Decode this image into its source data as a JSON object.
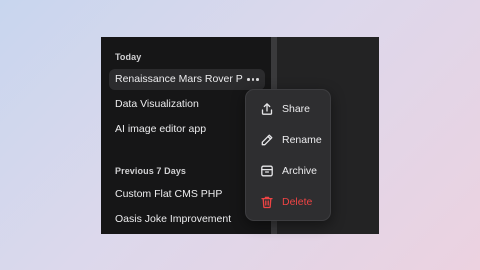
{
  "sidebar": {
    "sections": [
      {
        "heading": "Today",
        "items": [
          "Renaissance Mars Rover Pa",
          "Data Visualization",
          "AI image editor app"
        ]
      },
      {
        "heading": "Previous 7 Days",
        "items": [
          "Custom Flat CMS PHP",
          "Oasis Joke Improvement"
        ]
      }
    ]
  },
  "context_menu": {
    "items": [
      {
        "label": "Share",
        "icon": "share-icon"
      },
      {
        "label": "Rename",
        "icon": "pencil-icon"
      },
      {
        "label": "Archive",
        "icon": "archive-icon"
      },
      {
        "label": "Delete",
        "icon": "trash-icon",
        "color": "#ef4444"
      }
    ]
  },
  "colors": {
    "sidebar_bg": "#161617",
    "menu_bg": "#2e2e30",
    "danger": "#ef4444"
  }
}
